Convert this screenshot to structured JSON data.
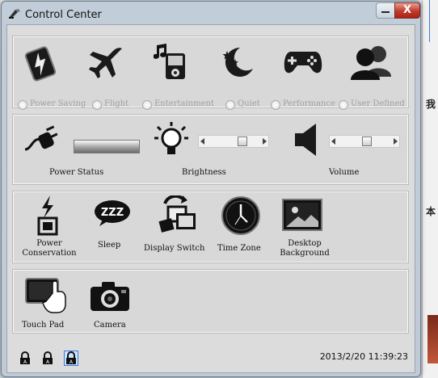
{
  "window": {
    "title": "Control Center",
    "close_label": "X"
  },
  "modes": [
    {
      "label": "Power Saving",
      "icon": "battery-bolt-icon"
    },
    {
      "label": "Flight",
      "icon": "airplane-icon"
    },
    {
      "label": "Entertainment",
      "icon": "music-player-icon"
    },
    {
      "label": "Quiet",
      "icon": "moon-stars-icon"
    },
    {
      "label": "Performance",
      "icon": "gamepad-icon"
    },
    {
      "label": "User Defined",
      "icon": "users-icon"
    }
  ],
  "settings": {
    "power_status": {
      "label": "Power Status",
      "icon": "power-plug-icon"
    },
    "brightness": {
      "label": "Brightness",
      "icon": "lightbulb-icon",
      "value_fraction": 0.7
    },
    "volume": {
      "label": "Volume",
      "icon": "speaker-icon",
      "value_fraction": 0.55
    }
  },
  "actions": [
    {
      "label": "Power Conservation",
      "line1": "Power",
      "line2": "Conservation",
      "icon": "power-conservation-icon"
    },
    {
      "label": "Sleep",
      "icon": "sleep-zzz-icon"
    },
    {
      "label": "Display Switch",
      "icon": "display-switch-icon"
    },
    {
      "label": "Time Zone",
      "icon": "clock-icon"
    },
    {
      "label": "Desktop Background",
      "line1": "Desktop",
      "line2": "Background",
      "icon": "desktop-background-icon"
    }
  ],
  "devices": [
    {
      "label": "Touch Pad",
      "icon": "touchpad-icon"
    },
    {
      "label": "Camera",
      "icon": "camera-icon"
    }
  ],
  "status": {
    "datetime": "2013/2/20 11:39:23",
    "locks": [
      "caps-lock-icon",
      "num-lock-icon",
      "scroll-lock-icon"
    ]
  },
  "background_text": {
    "right_char_1": "我",
    "right_char_2": "本"
  }
}
